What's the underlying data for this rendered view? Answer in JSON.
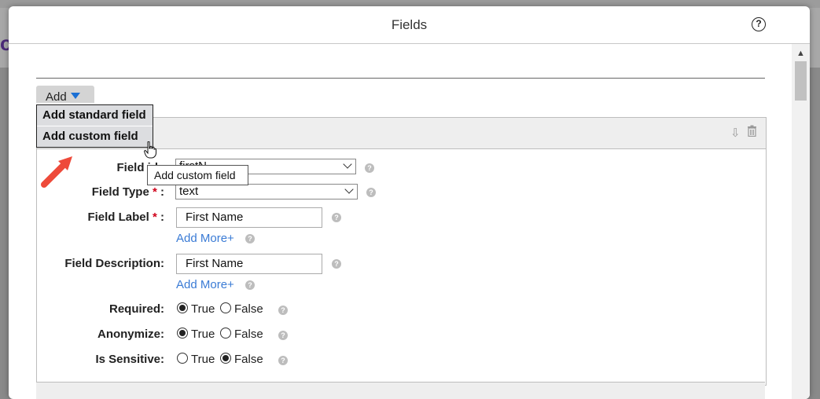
{
  "background": {
    "partial_title": "ol"
  },
  "dialog": {
    "title": "Fields",
    "help_icon": "question-circle-icon"
  },
  "toolbar": {
    "add_label": "Add"
  },
  "add_menu": {
    "items": [
      {
        "label": "Add standard field"
      },
      {
        "label": "Add custom field"
      }
    ]
  },
  "tooltip": {
    "text": "Add custom field"
  },
  "form": {
    "field_id": {
      "label": "Field id",
      "value": "firstN"
    },
    "field_type": {
      "label": "Field Type",
      "required_mark": "*",
      "colon": ":",
      "value": "text"
    },
    "field_label": {
      "label": "Field Label",
      "required_mark": "*",
      "colon": ":",
      "value": "First Name",
      "add_more": "Add More+"
    },
    "field_description": {
      "label": "Field Description:",
      "value": "First Name",
      "add_more": "Add More+"
    },
    "required": {
      "label": "Required:",
      "true_label": "True",
      "false_label": "False",
      "selected": "True"
    },
    "anonymize": {
      "label": "Anonymize:",
      "true_label": "True",
      "false_label": "False",
      "selected": "True"
    },
    "is_sensitive": {
      "label": "Is Sensitive:",
      "true_label": "True",
      "false_label": "False",
      "selected": "False"
    }
  },
  "colors": {
    "accent": "#1a6fd4",
    "link": "#3a7bd5",
    "required": "#d0021b",
    "annotation_arrow": "#ee4a3a"
  }
}
